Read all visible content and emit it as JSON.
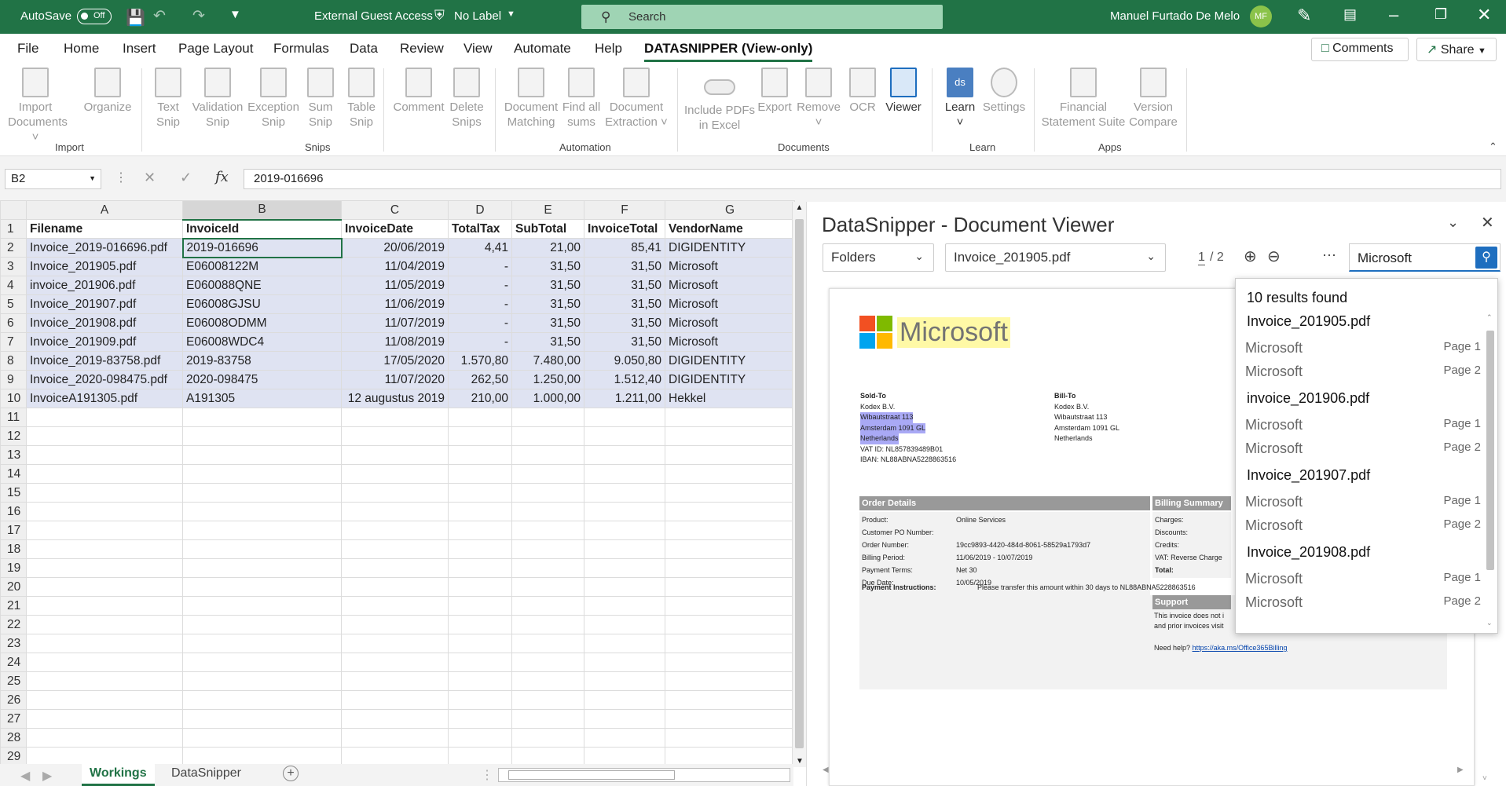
{
  "titlebar": {
    "autosave": "AutoSave",
    "toggle": "Off",
    "doc": "External Guest Access",
    "label": "No Label",
    "search": "Search",
    "user": "Manuel Furtado De Melo",
    "initials": "MF"
  },
  "menu": {
    "items": [
      "File",
      "Home",
      "Insert",
      "Page Layout",
      "Formulas",
      "Data",
      "Review",
      "View",
      "Automate",
      "Help",
      "DATASNIPPER (View-only)"
    ],
    "comments": "Comments",
    "share": "Share"
  },
  "ribbon": {
    "buttons": [
      [
        "Import",
        "Documents"
      ],
      [
        "Organize",
        ""
      ],
      [
        "Text",
        "Snip"
      ],
      [
        "Validation",
        "Snip"
      ],
      [
        "Exception",
        "Snip"
      ],
      [
        "Sum",
        "Snip"
      ],
      [
        "Table",
        "Snip"
      ],
      [
        "Comment",
        ""
      ],
      [
        "Delete",
        "Snips"
      ],
      [
        "Document",
        "Matching"
      ],
      [
        "Find all",
        "sums"
      ],
      [
        "Document",
        "Extraction"
      ],
      [
        "Include PDFs",
        "in Excel"
      ],
      [
        "Export",
        ""
      ],
      [
        "Remove",
        ""
      ],
      [
        "OCR",
        ""
      ],
      [
        "Viewer",
        ""
      ],
      [
        "Learn",
        ""
      ],
      [
        "Settings",
        ""
      ],
      [
        "Financial",
        "Statement Suite"
      ],
      [
        "Version",
        "Compare"
      ]
    ],
    "groups": [
      "Import",
      "Snips",
      "Automation",
      "Documents",
      "Learn",
      "Apps"
    ]
  },
  "formula": {
    "cell": "B2",
    "value": "2019-016696"
  },
  "sheet": {
    "cols": [
      "A",
      "B",
      "C",
      "D",
      "E",
      "F",
      "G"
    ],
    "rows": [
      [
        "Filename",
        "InvoiceId",
        "InvoiceDate",
        "TotalTax",
        "SubTotal",
        "InvoiceTotal",
        "VendorName"
      ],
      [
        "Invoice_2019-016696.pdf",
        "2019-016696",
        "20/06/2019",
        "4,41",
        "21,00",
        "85,41",
        "DIGIDENTITY"
      ],
      [
        "Invoice_201905.pdf",
        "E06008122M",
        "11/04/2019",
        "-",
        "31,50",
        "31,50",
        " Microsoft"
      ],
      [
        "invoice_201906.pdf",
        "E060088QNE",
        "11/05/2019",
        "-",
        "31,50",
        "31,50",
        "Microsoft"
      ],
      [
        "Invoice_201907.pdf",
        "E06008GJSU",
        "11/06/2019",
        "-",
        "31,50",
        "31,50",
        "Microsoft"
      ],
      [
        "Invoice_201908.pdf",
        "E06008ODMM",
        "11/07/2019",
        "-",
        "31,50",
        "31,50",
        "Microsoft"
      ],
      [
        "Invoice_201909.pdf",
        "E06008WDC4",
        "11/08/2019",
        "-",
        "31,50",
        "31,50",
        "Microsoft"
      ],
      [
        "Invoice_2019-83758.pdf",
        "2019-83758",
        "17/05/2020",
        "1.570,80",
        "7.480,00",
        "9.050,80",
        "DIGIDENTITY"
      ],
      [
        "Invoice_2020-098475.pdf",
        "2020-098475",
        "11/07/2020",
        "262,50",
        "1.250,00",
        "1.512,40",
        " DIGIDENTITY"
      ],
      [
        "InvoiceA191305.pdf",
        "A191305",
        "12 augustus 2019",
        "210,00",
        "1.000,00",
        "1.211,00",
        "Hekkel"
      ]
    ],
    "tabs": [
      "Workings",
      "DataSnipper"
    ]
  },
  "viewer": {
    "title": "DataSnipper - Document Viewer",
    "folders": "Folders",
    "file": "Invoice_201905.pdf",
    "page": "1",
    "pages": "/ 2",
    "search": "Microsoft",
    "results": "10 results found",
    "groups": [
      {
        "file": "Invoice_201905.pdf",
        "hits": [
          [
            "Microsoft",
            "Page 1"
          ],
          [
            "Microsoft",
            "Page 2"
          ]
        ]
      },
      {
        "file": "invoice_201906.pdf",
        "hits": [
          [
            "Microsoft",
            "Page 1"
          ],
          [
            "Microsoft",
            "Page 2"
          ]
        ]
      },
      {
        "file": "Invoice_201907.pdf",
        "hits": [
          [
            "Microsoft",
            "Page 1"
          ],
          [
            "Microsoft",
            "Page 2"
          ]
        ]
      },
      {
        "file": "Invoice_201908.pdf",
        "hits": [
          [
            "Microsoft",
            "Page 1"
          ],
          [
            "Microsoft",
            "Page 2"
          ]
        ]
      }
    ],
    "doc": {
      "logo": "Microsoft",
      "soldto": [
        "Sold-To",
        "Kodex B.V.",
        "Wibautstraat 113",
        "Amsterdam 1091 GL",
        "Netherlands",
        "VAT ID: NL857839489B01",
        "IBAN: NL88ABNA5228863516"
      ],
      "billto": [
        "Bill-To",
        "Kodex B.V.",
        "Wibautstraat 113",
        "Amsterdam 1091 GL",
        "Netherlands"
      ],
      "orderhdr": "Order Details",
      "billhdr": "Billing Summary",
      "order": [
        [
          "Product:",
          "Online Services"
        ],
        [
          "Customer PO Number:",
          ""
        ],
        [
          "Order Number:",
          "19cc9893-4420-484d-8061-58529a1793d7"
        ],
        [
          "Billing Period:",
          "11/06/2019 - 10/07/2019"
        ],
        [
          "Payment Terms:",
          "Net 30"
        ],
        [
          "Due Date:",
          "10/05/2019"
        ]
      ],
      "billing": [
        "Charges:",
        "Discounts:",
        "Credits:",
        "VAT: Reverse Charge",
        "Total:"
      ],
      "payment": "Payment Instructions:",
      "paytext": "Please transfer this amount within 30 days to NL88ABNA5228863516",
      "support": "Support",
      "supporttext": "This invoice does not i",
      "supporttext2": "and prior invoices visit",
      "help": "Need help?",
      "link": "https://aka.ms/Office365Billing"
    }
  }
}
